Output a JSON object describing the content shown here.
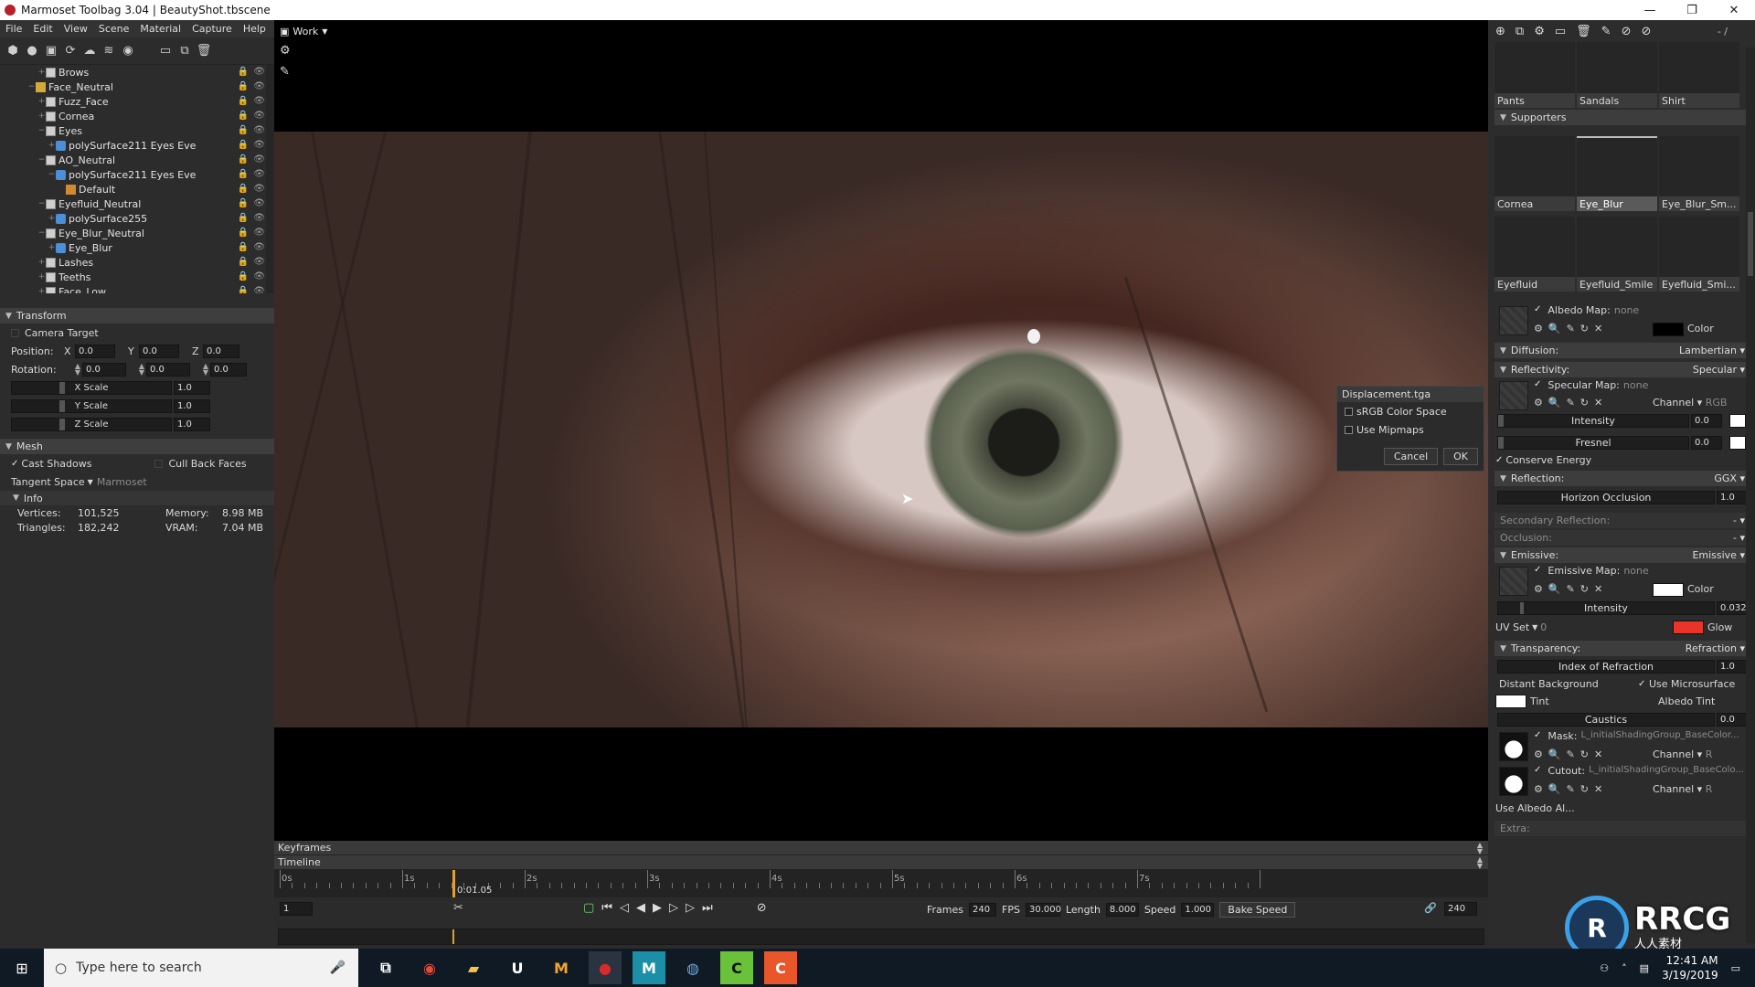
{
  "window": {
    "title": "Marmoset Toolbag 3.04  |  BeautyShot.tbscene",
    "controls": [
      "—",
      "❐",
      "✕"
    ]
  },
  "menu": [
    "File",
    "Edit",
    "View",
    "Scene",
    "Material",
    "Capture",
    "Help"
  ],
  "scene_tree": [
    {
      "label": "Brows",
      "type": "mesh",
      "depth": 3,
      "twisty": "+"
    },
    {
      "label": "Face_Neutral",
      "type": "folder",
      "depth": 2,
      "twisty": "−"
    },
    {
      "label": "Fuzz_Face",
      "type": "mesh",
      "depth": 3,
      "twisty": "+"
    },
    {
      "label": "Cornea",
      "type": "mesh",
      "depth": 3,
      "twisty": "+"
    },
    {
      "label": "Eyes",
      "type": "mesh",
      "depth": 3,
      "twisty": "−"
    },
    {
      "label": "polySurface211 Eyes Eve",
      "type": "sub",
      "depth": 4,
      "twisty": "+"
    },
    {
      "label": "AO_Neutral",
      "type": "mesh",
      "depth": 3,
      "twisty": "−"
    },
    {
      "label": "polySurface211 Eyes Eve",
      "type": "sub",
      "depth": 4,
      "twisty": "−"
    },
    {
      "label": "Default",
      "type": "mat",
      "depth": 5,
      "twisty": ""
    },
    {
      "label": "Eyefluid_Neutral",
      "type": "mesh",
      "depth": 3,
      "twisty": "−"
    },
    {
      "label": "polySurface255",
      "type": "sub",
      "depth": 4,
      "twisty": "+"
    },
    {
      "label": "Eye_Blur_Neutral",
      "type": "mesh",
      "depth": 3,
      "twisty": "−"
    },
    {
      "label": "Eye_Blur",
      "type": "sub",
      "depth": 4,
      "twisty": "+"
    },
    {
      "label": "Lashes",
      "type": "mesh",
      "depth": 3,
      "twisty": "+"
    },
    {
      "label": "Teeths",
      "type": "mesh",
      "depth": 3,
      "twisty": "+"
    },
    {
      "label": "Face_Low",
      "type": "mesh",
      "depth": 3,
      "twisty": "+"
    }
  ],
  "transform": {
    "title": "Transform",
    "camera_target": "Camera Target",
    "position_label": "Position:",
    "rotation_label": "Rotation:",
    "x": "X",
    "y": "Y",
    "z": "Z",
    "position": [
      "0.0",
      "0.0",
      "0.0"
    ],
    "rotation": [
      "0.0",
      "0.0",
      "0.0"
    ],
    "scale_labels": [
      "X Scale",
      "Y Scale",
      "Z Scale"
    ],
    "scale": [
      "1.0",
      "1.0",
      "1.0"
    ]
  },
  "mesh": {
    "title": "Mesh",
    "cast_shadows": "Cast Shadows",
    "cull_back_faces": "Cull Back Faces",
    "tangent_space_label": "Tangent Space",
    "tangent_space_value": "Marmoset",
    "info_title": "Info",
    "vertices_label": "Vertices:",
    "vertices": "101,525",
    "triangles_label": "Triangles:",
    "triangles": "182,242",
    "memory_label": "Memory:",
    "memory": "8.98 MB",
    "vram_label": "VRAM:",
    "vram": "7.04 MB"
  },
  "viewport": {
    "mode": "Work"
  },
  "dialog": {
    "title": "Displacement.tga",
    "srgb": "sRGB Color Space",
    "mipmaps": "Use Mipmaps",
    "cancel": "Cancel",
    "ok": "OK"
  },
  "timeline": {
    "keyframes": "Keyframes",
    "timeline": "Timeline",
    "seconds": [
      "0s",
      "1s",
      "2s",
      "3s",
      "4s",
      "5s",
      "6s",
      "7s"
    ],
    "current_time": "0:01.05",
    "frame": "1",
    "frames_label": "Frames",
    "frames": "240",
    "fps_label": "FPS",
    "fps": "30.000",
    "length_label": "Length",
    "length": "8.000",
    "speed_label": "Speed",
    "speed": "1.000",
    "bake_speed": "Bake Speed",
    "end_frame": "240"
  },
  "materials": {
    "toolbar_dash": "- /",
    "top_row": [
      "Pants",
      "Sandals",
      "Shirt"
    ],
    "supporters_title": "Supporters",
    "row2": [
      "Cornea",
      "Eye_Blur",
      "Eye_Blur_Sm..."
    ],
    "row3": [
      "Eyefluid",
      "Eyefluid_Smile",
      "Eyefluid_Smi..."
    ],
    "selected": "Eye_Blur"
  },
  "props": {
    "albedo_map": "Albedo Map:",
    "none": "none",
    "color": "Color",
    "diffusion": "Diffusion:",
    "diffusion_value": "Lambertian",
    "reflectivity": "Reflectivity:",
    "reflectivity_value": "Specular",
    "specular_map": "Specular Map:",
    "channel": "Channel",
    "channel_rgb": "RGB",
    "channel_r": "R",
    "intensity": "Intensity",
    "intensity_value": "0.0",
    "fresnel": "Fresnel",
    "fresnel_value": "0.0",
    "conserve_energy": "Conserve Energy",
    "reflection": "Reflection:",
    "reflection_value": "GGX",
    "horizon_occlusion": "Horizon Occlusion",
    "horizon_value": "1.0",
    "secondary_reflection": "Secondary Reflection:",
    "occlusion": "Occlusion:",
    "dash": "-",
    "emissive": "Emissive:",
    "emissive_value": "Emissive",
    "emissive_map": "Emissive Map:",
    "emissive_intensity": "0.032",
    "uv_set": "UV Set",
    "uv_value": "0",
    "glow": "Glow",
    "transparency": "Transparency:",
    "transparency_value": "Refraction",
    "ior": "Index of Refraction",
    "ior_value": "1.0",
    "distant_background": "Distant Background",
    "use_microsurface": "Use Microsurface",
    "tint": "Tint",
    "albedo_tint": "Albedo Tint",
    "caustics": "Caustics",
    "caustics_value": "0.0",
    "mask": "Mask:",
    "mask_value": "L_initialShadingGroup_BaseColor...",
    "cutout": "Cutout:",
    "cutout_value": "L_initialShadingGroup_BaseColo...",
    "use_albedo_alpha": "Use Albedo Al...",
    "extra": "Extra:"
  },
  "taskbar": {
    "search_placeholder": "Type here to search",
    "time": "12:41 AM",
    "date": "3/19/2019"
  },
  "watermark": {
    "logo": "R",
    "text": "RRCG",
    "sub": "人人素材"
  },
  "colors": {
    "accent_orange": "#e0a02c",
    "glow_red": "#e8342a",
    "panel": "#2c2c2c"
  }
}
